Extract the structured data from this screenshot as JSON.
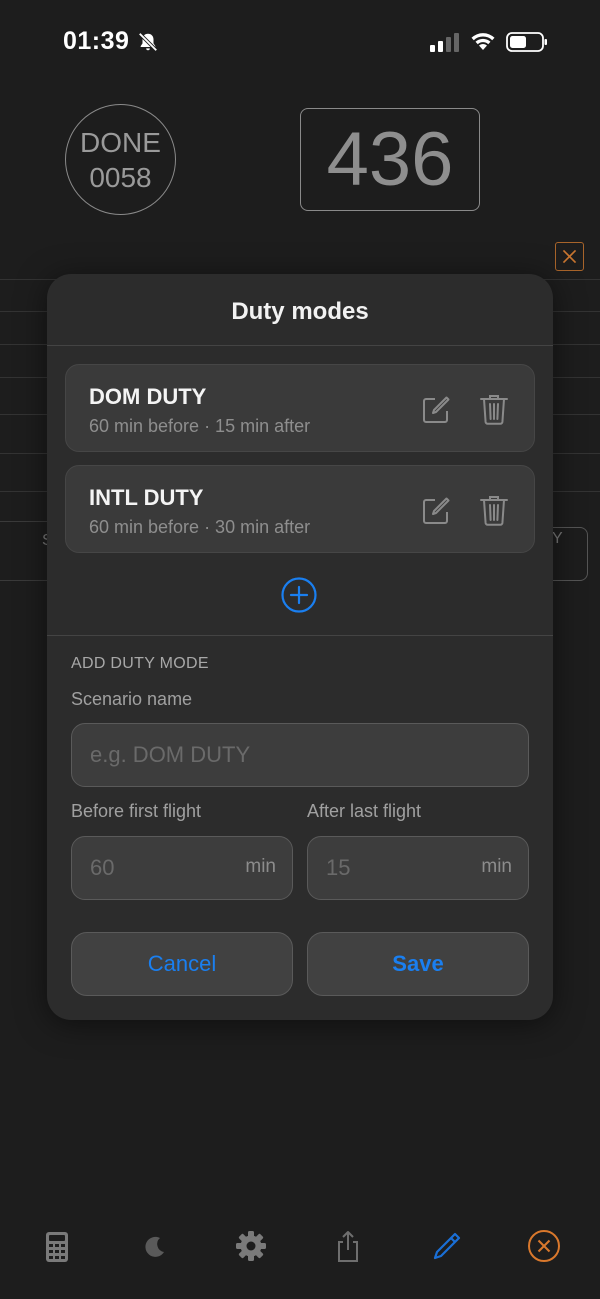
{
  "status": {
    "time": "01:39"
  },
  "header": {
    "done_label": "DONE",
    "done_count": "0058",
    "big_count": "436"
  },
  "background": {
    "left_fragment": "S",
    "right_fragment": "Y"
  },
  "modal": {
    "title": "Duty modes",
    "modes": [
      {
        "name": "DOM DUTY",
        "detail": "60 min before · 15 min after"
      },
      {
        "name": "INTL DUTY",
        "detail": "60 min before · 30 min after"
      }
    ],
    "add_section": {
      "title": "ADD DUTY MODE",
      "name_label": "Scenario name",
      "name_placeholder": "e.g. DOM DUTY",
      "before_label": "Before first flight",
      "before_placeholder": "60",
      "after_label": "After last flight",
      "after_placeholder": "15",
      "unit": "min"
    },
    "cancel_label": "Cancel",
    "save_label": "Save"
  },
  "toolbar": {
    "items": [
      "calculator-icon",
      "moon-icon",
      "gear-icon",
      "share-icon",
      "pencil-icon",
      "close-circle-icon"
    ]
  },
  "colors": {
    "accent_blue": "#1a7ff0",
    "accent_orange": "#d9782c",
    "background": "#1d1d1d",
    "modal": "#2c2c2c"
  }
}
